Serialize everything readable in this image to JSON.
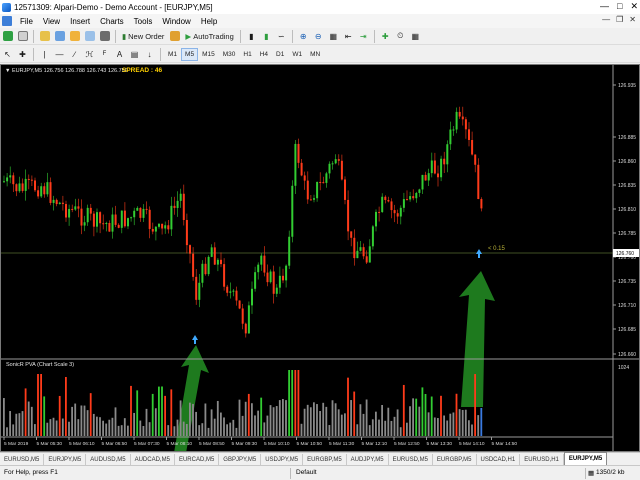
{
  "window": {
    "title": "12571309: Alpari-Demo - Demo Account - [EURJPY,M5]"
  },
  "menu": [
    "File",
    "View",
    "Insert",
    "Charts",
    "Tools",
    "Window",
    "Help"
  ],
  "toolbar": {
    "new_order": "New Order",
    "auto_trading": "AutoTrading"
  },
  "periods": [
    "M1",
    "M5",
    "M15",
    "M30",
    "H1",
    "H4",
    "D1",
    "W1",
    "MN"
  ],
  "active_period": "M5",
  "chart": {
    "symbol_line": "▼ EURJPY,M5  126.756 126.788 126.743 126.759",
    "spread": "SPREAD : 46",
    "indicator_label": "SonicR PVA  (Chart Scale 3)",
    "price_ticks": [
      "126.935",
      "126.885",
      "126.860",
      "126.835",
      "126.810",
      "126.785",
      "126.760",
      "126.735",
      "126.710",
      "126.685",
      "126.660",
      "126.655"
    ],
    "current_price": "126.760",
    "spread_marker": "< 0.15",
    "volume_tick": "1024",
    "time_ticks": [
      "5 Mar 2019",
      "5 Mar 05:30",
      "5 Mar 06:10",
      "5 Mar 06:50",
      "5 Mar 07:30",
      "5 Mar 08:10",
      "5 Mar 08:50",
      "5 Mar 09:30",
      "5 Mar 10:10",
      "5 Mar 10:50",
      "5 Mar 11:30",
      "5 Mar 12:10",
      "5 Mar 12:50",
      "5 Mar 13:30",
      "5 Mar 14:10",
      "5 Mar 14:50"
    ],
    "colors": {
      "bull": "#32cd32",
      "bear": "#ff3b1a",
      "bg": "#000000",
      "arrow": "#1e7a1e",
      "signal": "#3fa9ff",
      "level": "#556b2f"
    }
  },
  "tabs": [
    "EURUSD,M5",
    "EURJPY,M5",
    "AUDUSD,M5",
    "AUDCAD,M5",
    "EURCAD,M5",
    "GBPJPY,M5",
    "USDJPY,M5",
    "EURGBP,M5",
    "AUDJPY,M5",
    "EURUSD,M5",
    "EURGBP,M5",
    "USDCAD,H1",
    "EURUSD,H1",
    "EURJPY,M5"
  ],
  "active_tab": 13,
  "status": {
    "help": "For Help, press F1",
    "profile": "Default",
    "traffic": "1350/2 kb"
  }
}
